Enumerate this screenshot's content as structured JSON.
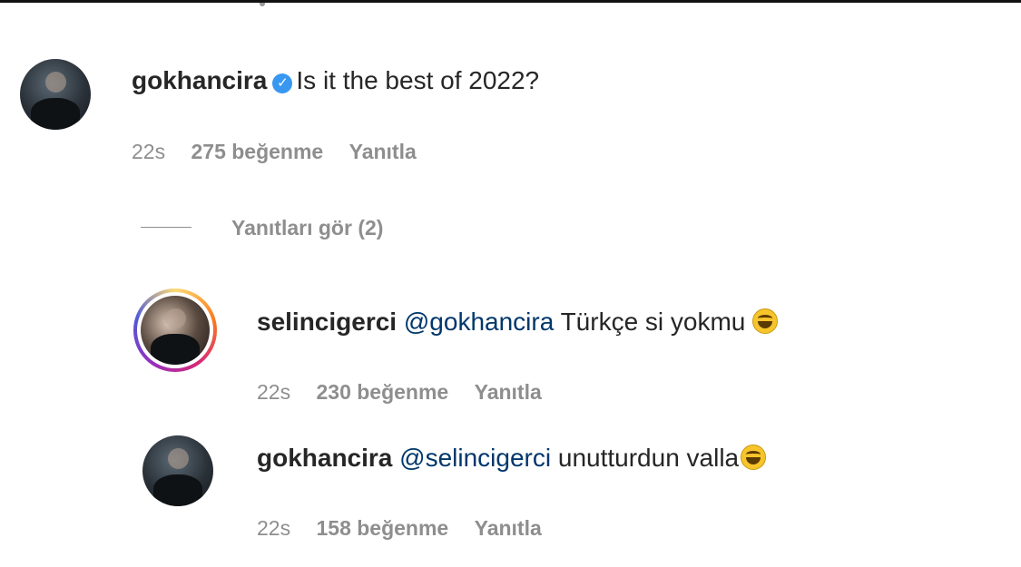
{
  "comments": [
    {
      "username": "gokhancira",
      "verified": true,
      "mention": "",
      "text": "Is it the best of 2022?",
      "emoji": "",
      "time": "22s",
      "likes": "275 beğenme",
      "reply": "Yanıtla"
    }
  ],
  "view_replies": "Yanıtları gör (2)",
  "replies": [
    {
      "username": "selincigerci",
      "mention": "@gokhancira",
      "text": "Türkçe si yokmu",
      "emoji": "face-with-tears-of-joy",
      "time": "22s",
      "likes": "230 beğenme",
      "reply": "Yanıtla",
      "story_ring": true
    },
    {
      "username": "gokhancira",
      "mention": "@selincigerci",
      "text": "unutturdun valla",
      "emoji": "face-with-tears-of-joy",
      "time": "22s",
      "likes": "158 beğenme",
      "reply": "Yanıtla",
      "story_ring": false
    }
  ],
  "colors": {
    "mention": "#00376b",
    "verified": "#3897f0",
    "meta": "#8e8e8e"
  }
}
